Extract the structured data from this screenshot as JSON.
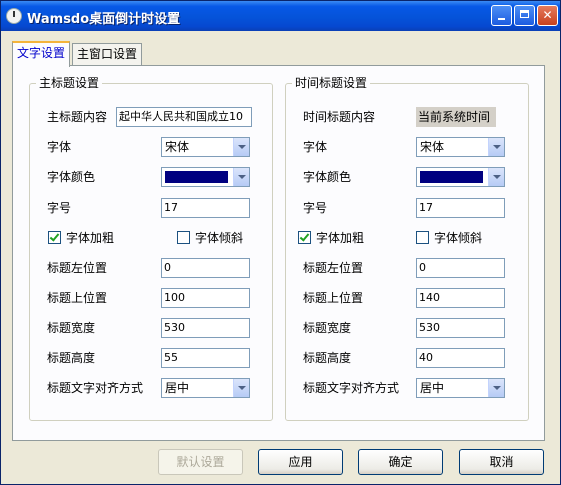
{
  "window": {
    "title": "Wamsdo桌面倒计时设置"
  },
  "tabs": [
    {
      "label": "文字设置"
    },
    {
      "label": "主窗口设置"
    }
  ],
  "main_title": {
    "group_label": "主标题设置",
    "content": {
      "label": "主标题内容",
      "value_selected": "起中华人民共和",
      "value_rest": "国成立10"
    },
    "font": {
      "label": "字体",
      "value": "宋体"
    },
    "color": {
      "label": "字体颜色",
      "value": "#000080"
    },
    "size": {
      "label": "字号",
      "value": "17"
    },
    "bold": {
      "label": "字体加粗",
      "checked": true
    },
    "italic": {
      "label": "字体倾斜",
      "checked": false
    },
    "left": {
      "label": "标题左位置",
      "value": "0"
    },
    "top": {
      "label": "标题上位置",
      "value": "100"
    },
    "width": {
      "label": "标题宽度",
      "value": "530"
    },
    "height": {
      "label": "标题高度",
      "value": "55"
    },
    "align": {
      "label": "标题文字对齐方式",
      "value": "居中"
    }
  },
  "time_title": {
    "group_label": "时间标题设置",
    "content": {
      "label": "时间标题内容",
      "value": "当前系统时间"
    },
    "font": {
      "label": "字体",
      "value": "宋体"
    },
    "color": {
      "label": "字体颜色",
      "value": "#000080"
    },
    "size": {
      "label": "字号",
      "value": "17"
    },
    "bold": {
      "label": "字体加粗",
      "checked": true
    },
    "italic": {
      "label": "字体倾斜",
      "checked": false
    },
    "left": {
      "label": "标题左位置",
      "value": "0"
    },
    "top": {
      "label": "标题上位置",
      "value": "140"
    },
    "width": {
      "label": "标题宽度",
      "value": "530"
    },
    "height": {
      "label": "标题高度",
      "value": "40"
    },
    "align": {
      "label": "标题文字对齐方式",
      "value": "居中"
    }
  },
  "buttons": {
    "default": "默认设置",
    "apply": "应用",
    "ok": "确定",
    "cancel": "取消"
  }
}
